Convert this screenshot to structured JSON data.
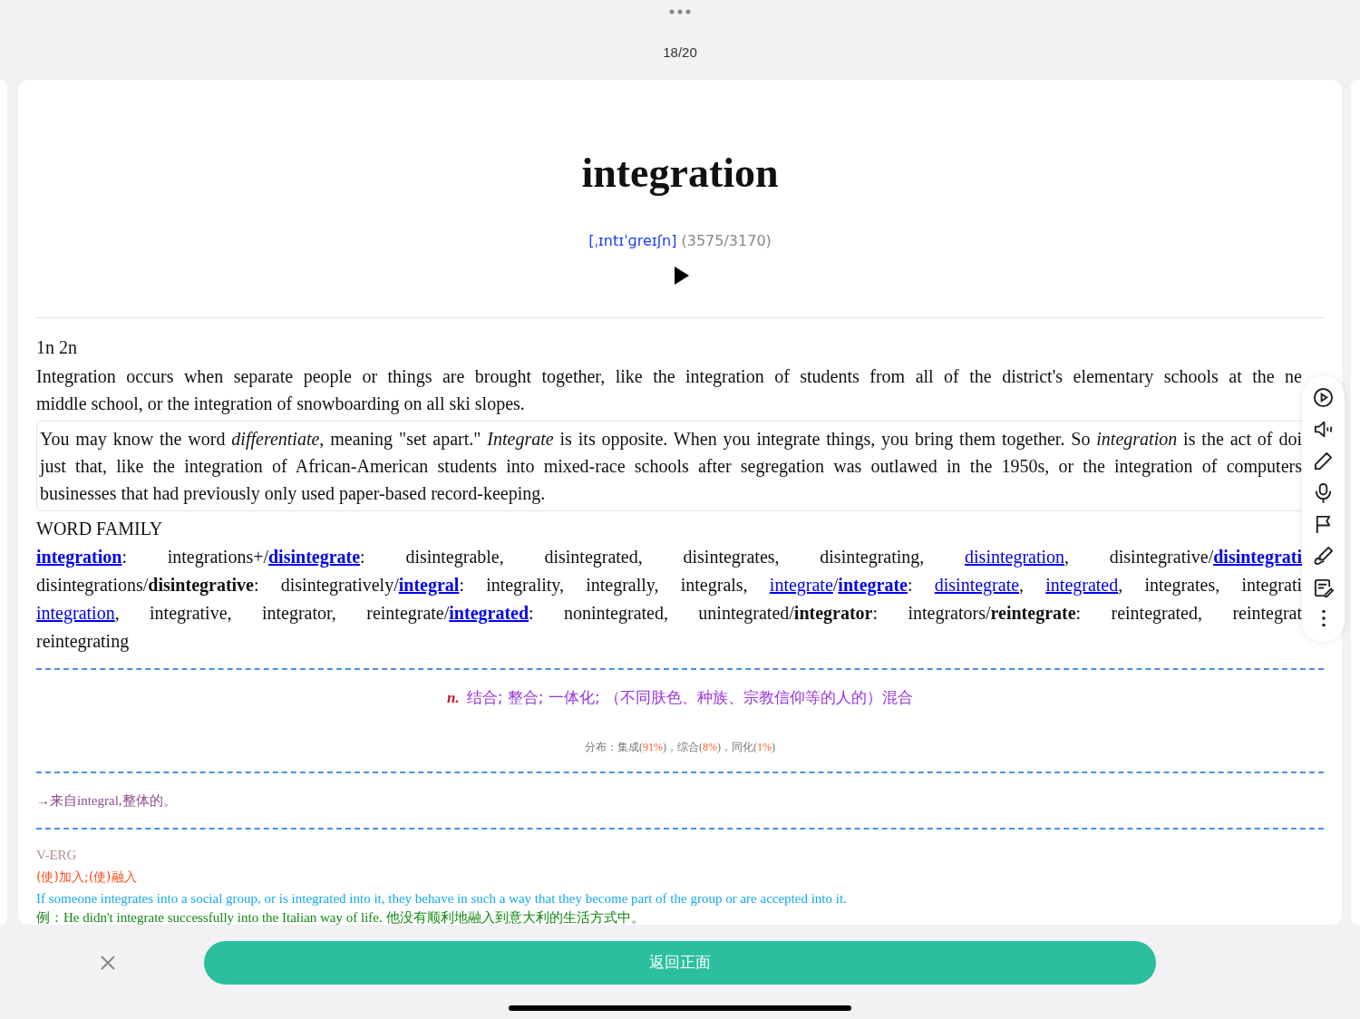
{
  "counter": "18/20",
  "word": {
    "headword": "integration",
    "phonetic": "[ˌɪntɪˈɡreɪʃn]",
    "frequency": "(3575/3170)"
  },
  "definition": {
    "tag": "1n 2n",
    "lines": [
      "Integration occurs when separate people or things are brought together, like the integration of students from all of the district's elementary schools at the ne",
      "middle school, or the integration of snowboarding on all ski slopes."
    ]
  },
  "note_box": {
    "lines": [
      "You may know the word *differentiate*, meaning \"set apart.\" *Integrate* is its opposite. When you integrate things, you bring them together. So *integration* is the act of doi",
      "just that, like the integration of African-American students into mixed-race schools after segregation was outlawed in the 1950s, or the integration of computers",
      "businesses that had previously only used paper-based record-keeping."
    ]
  },
  "word_family": {
    "heading": "WORD FAMILY",
    "lines": [
      [
        {
          "text": "integration",
          "link": true,
          "bold": true
        },
        {
          "text": ":  integrations+/",
          "link": false,
          "bold": false
        },
        {
          "text": "disintegrate",
          "link": true,
          "bold": true
        },
        {
          "text": ": disintegrable, disintegrated, disintegrates, disintegrating, ",
          "link": false,
          "bold": false
        },
        {
          "text": "disintegration",
          "link": true,
          "bold": false
        },
        {
          "text": ", disintegrative/",
          "link": false,
          "bold": false
        },
        {
          "text": "disintegrati",
          "link": true,
          "bold": true
        }
      ],
      [
        {
          "text": "disintegrations/",
          "link": false,
          "bold": false
        },
        {
          "text": "disintegrative",
          "link": false,
          "bold": true
        },
        {
          "text": ": disintegratively/",
          "link": false,
          "bold": false
        },
        {
          "text": "integral",
          "link": true,
          "bold": true
        },
        {
          "text": ": integrality, integrally, integrals, ",
          "link": false,
          "bold": false
        },
        {
          "text": "integrate",
          "link": true,
          "bold": false
        },
        {
          "text": "/",
          "link": false,
          "bold": false
        },
        {
          "text": "integrate",
          "link": true,
          "bold": true
        },
        {
          "text": ": ",
          "link": false,
          "bold": false
        },
        {
          "text": "disintegrate",
          "link": true,
          "bold": false
        },
        {
          "text": ", ",
          "link": false,
          "bold": false
        },
        {
          "text": "integrated",
          "link": true,
          "bold": false
        },
        {
          "text": ", integrates, integrati",
          "link": false,
          "bold": false
        }
      ],
      [
        {
          "text": "integration",
          "link": true,
          "bold": false
        },
        {
          "text": ", integrative, integrator, reintegrate/",
          "link": false,
          "bold": false
        },
        {
          "text": "integrated",
          "link": true,
          "bold": true
        },
        {
          "text": ": nonintegrated, unintegrated/",
          "link": false,
          "bold": false
        },
        {
          "text": "integrator",
          "link": false,
          "bold": true
        },
        {
          "text": ": integrators/",
          "link": false,
          "bold": false
        },
        {
          "text": "reintegrate",
          "link": false,
          "bold": true
        },
        {
          "text": ": reintegrated, reintegrat",
          "link": false,
          "bold": false
        }
      ],
      [
        {
          "text": "reintegrating",
          "link": false,
          "bold": false
        }
      ]
    ]
  },
  "chinese": {
    "pos": "n.",
    "meaning": "结合; 整合; 一体化; （不同肤色、种族、宗教信仰等的人的）混合",
    "distribution": [
      {
        "text": "分布：集成(",
        "highlight": false
      },
      {
        "text": "91%",
        "highlight": true
      },
      {
        "text": ")，综合(",
        "highlight": false
      },
      {
        "text": "8%",
        "highlight": true
      },
      {
        "text": ")，同化(",
        "highlight": false
      },
      {
        "text": "1%",
        "highlight": true
      },
      {
        "text": ")",
        "highlight": false
      }
    ]
  },
  "etymology": "→来自integral,整体的。",
  "collins": {
    "label": "V-ERG",
    "meaning": "(使)加入;(使)融入",
    "definition": "If someone integrates into a social group, or is integrated into it, they behave in such a way that they become part of the group or are accepted into it.",
    "example": "例：He didn't integrate successfully into the Italian way of life. 他没有顺利地融入到意大利的生活方式中。"
  },
  "back_button": "返回正面"
}
